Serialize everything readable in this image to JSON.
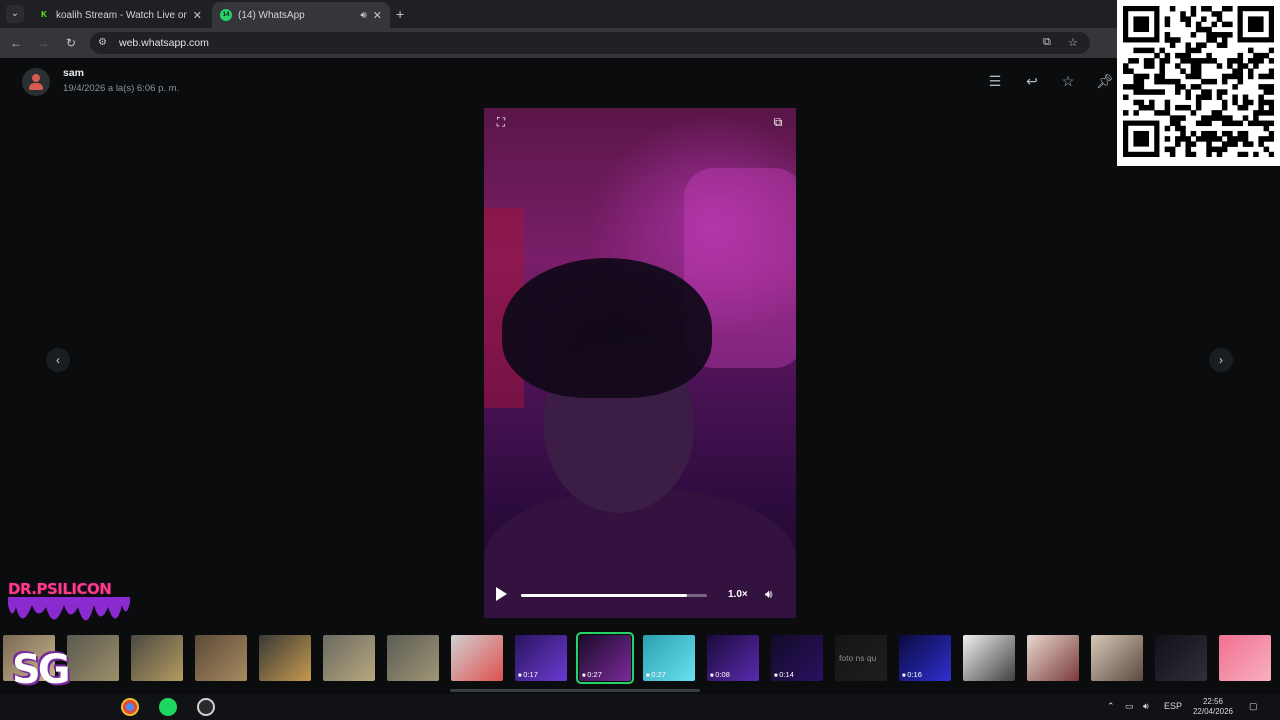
{
  "browser": {
    "tabs": [
      {
        "title": "koalih Stream - Watch Live on K",
        "favicon": "kick-icon",
        "active": false
      },
      {
        "title": "(14) WhatsApp",
        "favicon": "whatsapp-icon",
        "badge": "14",
        "active": true
      }
    ],
    "url": "web.whatsapp.com"
  },
  "viewer": {
    "sender": "sam",
    "timestamp": "19/4/2026 a la(s) 6:06 p. m.",
    "video": {
      "speed": "1.0×",
      "progress": 0.89
    }
  },
  "thumbnails": [
    {
      "kind": "image",
      "colors": [
        "#7a6a55",
        "#c9b48c"
      ]
    },
    {
      "kind": "image",
      "colors": [
        "#5a5a50",
        "#9c8f6a"
      ]
    },
    {
      "kind": "image",
      "colors": [
        "#4a4a42",
        "#b59b60"
      ]
    },
    {
      "kind": "image",
      "colors": [
        "#5b4a3a",
        "#a88a60"
      ]
    },
    {
      "kind": "image",
      "colors": [
        "#3a3a36",
        "#c49a50"
      ]
    },
    {
      "kind": "image",
      "colors": [
        "#6a6a60",
        "#b8a880"
      ]
    },
    {
      "kind": "image",
      "colors": [
        "#5c5c55",
        "#a09676"
      ]
    },
    {
      "kind": "image",
      "colors": [
        "#d0d0d0",
        "#e05050"
      ]
    },
    {
      "kind": "video",
      "duration": "0:17",
      "colors": [
        "#2a1560",
        "#6a3ad0"
      ]
    },
    {
      "kind": "video",
      "duration": "0:27",
      "colors": [
        "#1a0c28",
        "#7a2a9a"
      ],
      "selected": true
    },
    {
      "kind": "video",
      "duration": "0:27",
      "colors": [
        "#2aa0b0",
        "#6ae0f0"
      ]
    },
    {
      "kind": "video",
      "duration": "0:08",
      "colors": [
        "#1a0a3a",
        "#5a2ab0"
      ]
    },
    {
      "kind": "video",
      "duration": "0:14",
      "colors": [
        "#120a28",
        "#2a1260"
      ]
    },
    {
      "kind": "text",
      "text": "foto ns qu",
      "colors": [
        "#151515",
        "#1e1e1e"
      ]
    },
    {
      "kind": "video",
      "duration": "0:16",
      "colors": [
        "#0a0a40",
        "#3030d0"
      ]
    },
    {
      "kind": "image",
      "colors": [
        "#f0f0f0",
        "#404040"
      ]
    },
    {
      "kind": "image",
      "colors": [
        "#e8d8d0",
        "#7a3a3a"
      ]
    },
    {
      "kind": "image",
      "colors": [
        "#d8c8b8",
        "#5a4a40"
      ]
    },
    {
      "kind": "image",
      "colors": [
        "#101018",
        "#30303a"
      ]
    },
    {
      "kind": "image",
      "colors": [
        "#f07090",
        "#f8b0c0"
      ]
    }
  ],
  "taskbar": {
    "language": "ESP",
    "time": "22:56",
    "date": "22/04/2026"
  },
  "overlays": {
    "channel_logo_text": "DR.PSILICON",
    "badge_text": "SG"
  },
  "colors": {
    "accent": "#25d366",
    "background": "#0b0c0d"
  }
}
